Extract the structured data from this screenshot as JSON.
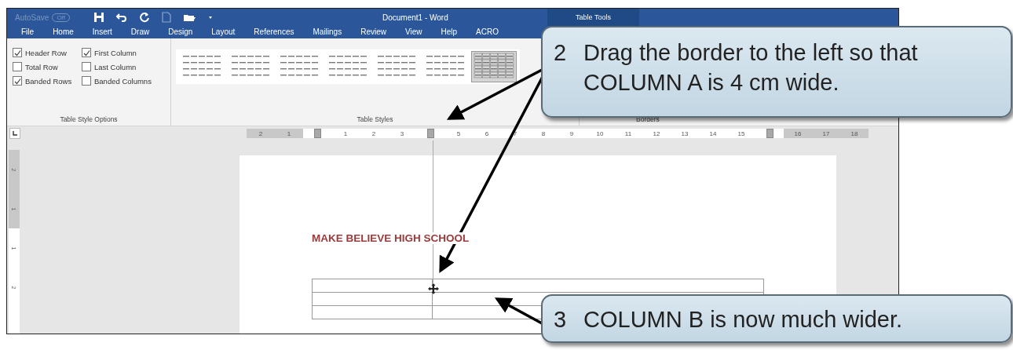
{
  "window": {
    "autosave_label": "AutoSave",
    "autosave_state": "Off",
    "title": "Document1  -  Word",
    "context_tab": "Table Tools"
  },
  "tabs": [
    {
      "label": "File",
      "selected": false
    },
    {
      "label": "Home",
      "selected": false
    },
    {
      "label": "Insert",
      "selected": false
    },
    {
      "label": "Draw",
      "selected": false
    },
    {
      "label": "Design",
      "selected": false
    },
    {
      "label": "Layout",
      "selected": false
    },
    {
      "label": "References",
      "selected": false
    },
    {
      "label": "Mailings",
      "selected": false
    },
    {
      "label": "Review",
      "selected": false
    },
    {
      "label": "View",
      "selected": false
    },
    {
      "label": "Help",
      "selected": false
    },
    {
      "label": "ACRO",
      "selected": false
    }
  ],
  "ribbon": {
    "style_options": {
      "label": "Table Style Options",
      "options": [
        {
          "label": "Header Row",
          "checked": true
        },
        {
          "label": "First Column",
          "checked": true
        },
        {
          "label": "Total Row",
          "checked": false
        },
        {
          "label": "Last Column",
          "checked": false
        },
        {
          "label": "Banded Rows",
          "checked": true
        },
        {
          "label": "Banded Columns",
          "checked": false
        }
      ]
    },
    "table_styles": {
      "label": "Table Styles",
      "styles": [
        {
          "selected": false
        },
        {
          "selected": false
        },
        {
          "selected": false
        },
        {
          "selected": false
        },
        {
          "selected": false
        },
        {
          "selected": false
        },
        {
          "selected": true
        }
      ]
    },
    "borders": {
      "label": "Borders"
    }
  },
  "ruler": [
    {
      "kind": "number",
      "label": "2",
      "margin": true
    },
    {
      "kind": "number",
      "label": "1",
      "margin": true
    },
    {
      "kind": "marker"
    },
    {
      "kind": "number",
      "label": "1",
      "margin": false
    },
    {
      "kind": "number",
      "label": "2",
      "margin": false
    },
    {
      "kind": "number",
      "label": "3",
      "margin": false
    },
    {
      "kind": "marker"
    },
    {
      "kind": "number",
      "label": "5",
      "margin": false
    },
    {
      "kind": "number",
      "label": "6",
      "margin": false
    },
    {
      "kind": "number",
      "label": "7",
      "margin": false
    },
    {
      "kind": "number",
      "label": "8",
      "margin": false
    },
    {
      "kind": "number",
      "label": "9",
      "margin": false
    },
    {
      "kind": "number",
      "label": "10",
      "margin": false
    },
    {
      "kind": "number",
      "label": "11",
      "margin": false
    },
    {
      "kind": "number",
      "label": "12",
      "margin": false
    },
    {
      "kind": "number",
      "label": "13",
      "margin": false
    },
    {
      "kind": "number",
      "label": "14",
      "margin": false
    },
    {
      "kind": "number",
      "label": "15",
      "margin": false
    },
    {
      "kind": "marker"
    },
    {
      "kind": "number",
      "label": "16",
      "margin": true
    },
    {
      "kind": "number",
      "label": "17",
      "margin": true
    },
    {
      "kind": "number",
      "label": "18",
      "margin": true
    }
  ],
  "vertical_ruler": [
    {
      "label": "2",
      "margin": true
    },
    {
      "label": "1",
      "margin": true
    },
    {
      "label": "1",
      "margin": false
    },
    {
      "label": "2",
      "margin": false
    }
  ],
  "document": {
    "heading": "MAKE BELIEVE HIGH SCHOOL",
    "table": {
      "rows": [
        {
          "cells": [
            {
              "kind": "empty"
            },
            {
              "kind": "empty"
            }
          ]
        },
        {
          "cells": [
            {
              "kind": "empty"
            },
            {
              "kind": "empty"
            }
          ]
        },
        {
          "cells": [
            {
              "kind": "empty"
            },
            {
              "kind": "empty"
            }
          ]
        }
      ]
    }
  },
  "callouts": [
    {
      "number": "2",
      "text": "Drag the border to the left so that COLUMN A is 4 cm wide."
    },
    {
      "number": "3",
      "text": "COLUMN B is now much wider."
    }
  ]
}
